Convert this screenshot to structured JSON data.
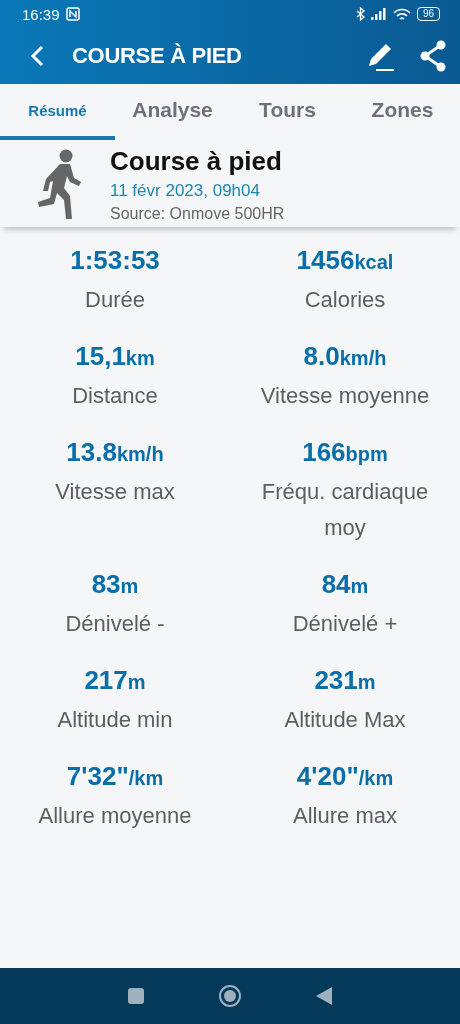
{
  "status_bar": {
    "time": "16:39",
    "battery": "96"
  },
  "app_bar": {
    "title": "COURSE À PIED"
  },
  "tabs": [
    {
      "label": "Résumé",
      "selected": true
    },
    {
      "label": "Analyse",
      "selected": false
    },
    {
      "label": "Tours",
      "selected": false
    },
    {
      "label": "Zones",
      "selected": false
    }
  ],
  "activity": {
    "title": "Course à pied",
    "date": "11 févr 2023, 09h04",
    "source": "Source: Onmove 500HR"
  },
  "stats": [
    {
      "value": "1:53:53",
      "label": "Durée"
    },
    {
      "value": "1456",
      "unit": "kcal",
      "label": "Calories"
    },
    {
      "value": "15,1",
      "unit": "km",
      "label": "Distance"
    },
    {
      "value": "8.0",
      "unit": "km/h",
      "label": "Vitesse moyenne"
    },
    {
      "value": "13.8",
      "unit": "km/h",
      "label": "Vitesse max"
    },
    {
      "value": "166",
      "unit": "bpm",
      "label": "Fréqu. cardiaque moy"
    },
    {
      "value": "83",
      "unit": "m",
      "label": "Dénivelé -"
    },
    {
      "value": "84",
      "unit": "m",
      "label": "Dénivelé +"
    },
    {
      "value": "217",
      "unit": "m",
      "label": "Altitude min"
    },
    {
      "value": "231",
      "unit": "m",
      "label": "Altitude Max"
    },
    {
      "value": "7'32\"",
      "unit": "/km",
      "label": "Allure moyenne"
    },
    {
      "value": "4'20\"",
      "unit": "/km",
      "label": "Allure max"
    }
  ]
}
